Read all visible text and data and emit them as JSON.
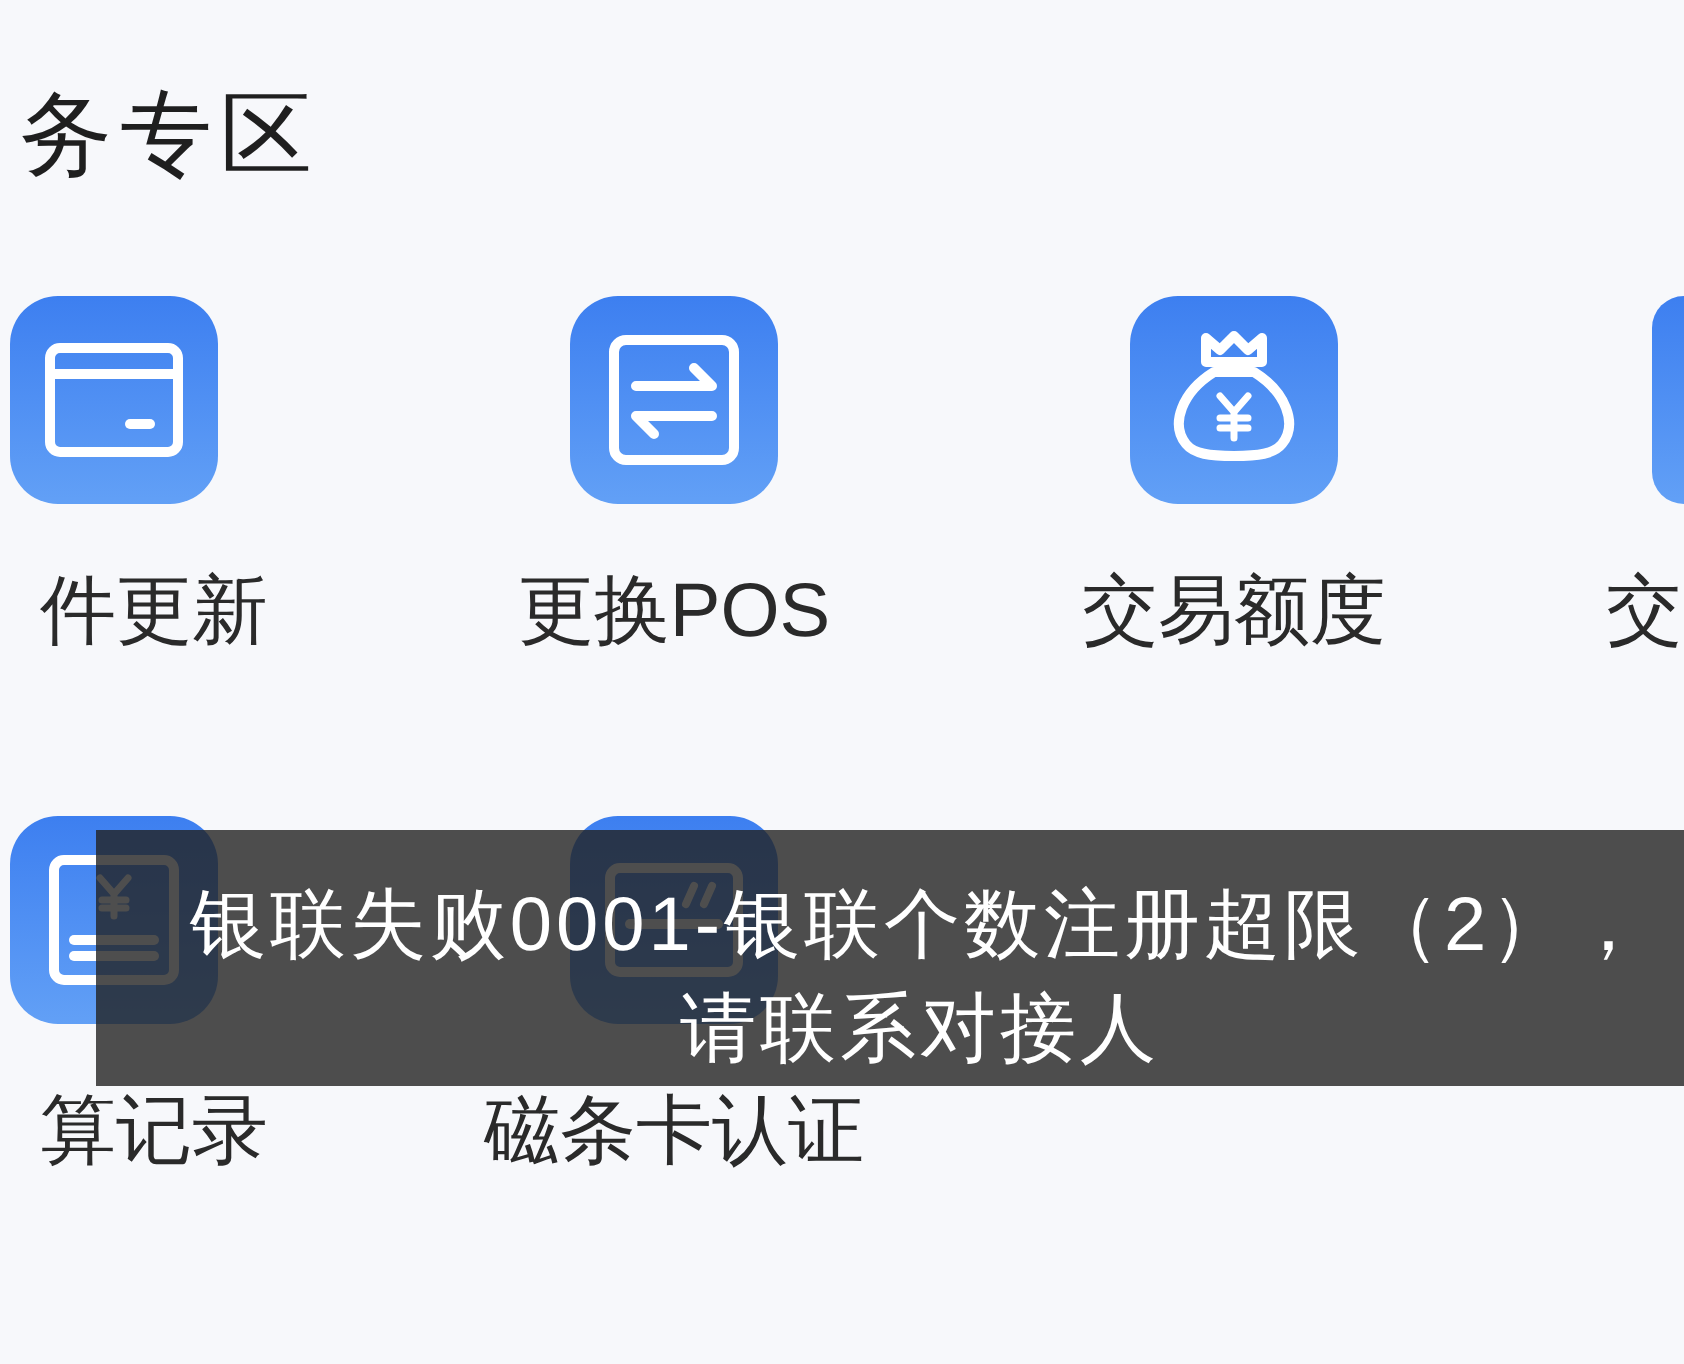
{
  "section": {
    "title": "务专区"
  },
  "services": [
    {
      "label": "件更新"
    },
    {
      "label": "更换POS"
    },
    {
      "label": "交易额度"
    },
    {
      "label": "交"
    },
    {
      "label": "算记录"
    },
    {
      "label": "磁条卡认证"
    }
  ],
  "toast": {
    "message": "银联失败0001-银联个数注册超限（2），请联系对接人"
  }
}
